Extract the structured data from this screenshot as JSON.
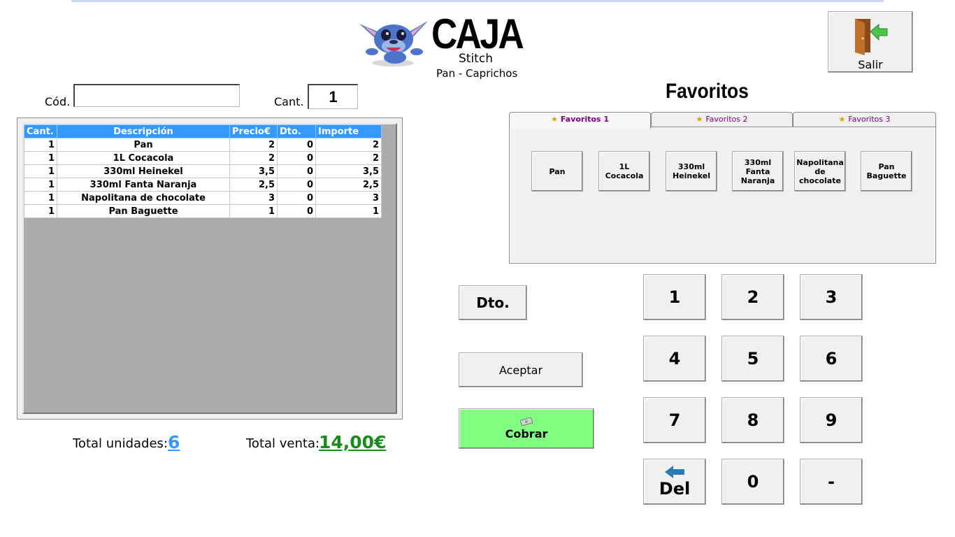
{
  "header": {
    "title": "CAJA",
    "subtitle": "Stitch",
    "shop": "Pan - Caprichos",
    "exit_label": "Salir"
  },
  "inputs": {
    "code_label": "Cód.",
    "code_value": "",
    "qty_label": "Cant.",
    "qty_value": "1"
  },
  "table": {
    "columns": [
      "Cant.",
      "Descripción",
      "Precio€",
      "Dto.",
      "Importe"
    ],
    "rows": [
      [
        "1",
        "Pan",
        "2",
        "0",
        "2"
      ],
      [
        "1",
        "1L Cocacola",
        "2",
        "0",
        "2"
      ],
      [
        "1",
        "330ml Heinekel",
        "3,5",
        "0",
        "3,5"
      ],
      [
        "1",
        "330ml Fanta Naranja",
        "2,5",
        "0",
        "2,5"
      ],
      [
        "1",
        "Napolitana de chocolate",
        "3",
        "0",
        "3"
      ],
      [
        "1",
        "Pan Baguette",
        "1",
        "0",
        "1"
      ]
    ]
  },
  "totals": {
    "units_label": "Total unidades:",
    "units_value": "6",
    "sale_label": "Total venta:",
    "sale_value": "14,00€"
  },
  "favorites": {
    "title": "Favoritos",
    "tabs": [
      "Favoritos 1",
      "Favoritos 2",
      "Favoritos 3"
    ],
    "active_tab": "Favoritos 1",
    "buttons": [
      "Pan",
      "1L\nCocacola",
      "330ml\nHeinekel",
      "330ml\nFanta\nNaranja",
      "Napolitana\nde\nchocolate",
      "Pan\nBaguette"
    ]
  },
  "actions": {
    "dto_label": "Dto.",
    "accept_label": "Aceptar",
    "charge_label": "Cobrar",
    "charge_color": "#80ff80"
  },
  "keypad": {
    "keys": [
      "1",
      "2",
      "3",
      "4",
      "5",
      "6",
      "7",
      "8",
      "9",
      "Del",
      "0",
      "-"
    ]
  },
  "colors": {
    "header_blue": "#3399ff",
    "units_blue": "#3399ff",
    "sale_green": "#1a8a1a",
    "tab_text": "#800080"
  },
  "icons": {
    "exit": "door-exit-icon",
    "charge": "money-icon",
    "delete": "back-arrow-icon",
    "tab": "star-icon"
  }
}
